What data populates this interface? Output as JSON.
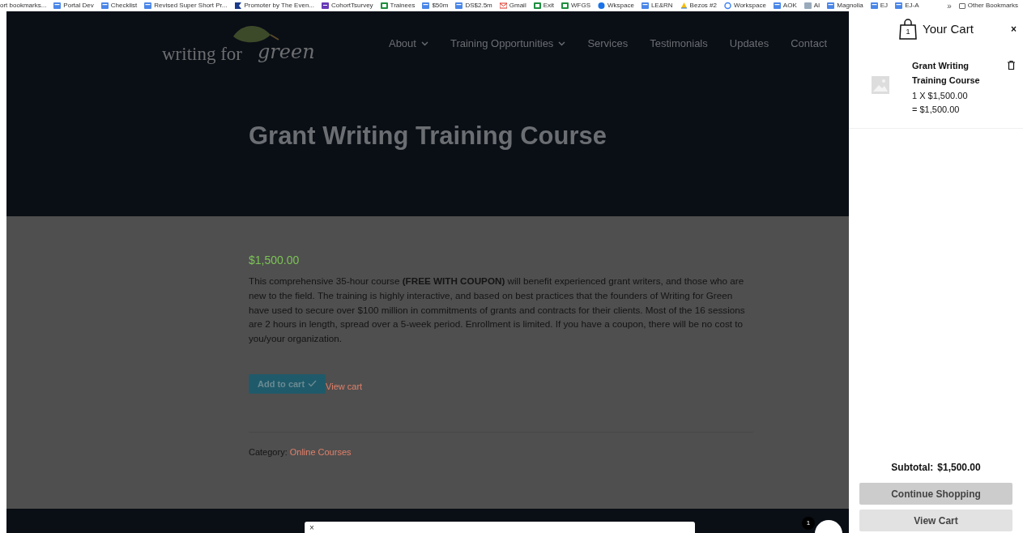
{
  "bookmarks_bar": {
    "items": [
      {
        "label": "ort bookmarks...",
        "kind": "none"
      },
      {
        "label": "Portal Dev",
        "kind": "doc"
      },
      {
        "label": "Checklist",
        "kind": "doc"
      },
      {
        "label": "Revised Super Short Pr...",
        "kind": "doc"
      },
      {
        "label": "Promoter by The Even...",
        "kind": "flag"
      },
      {
        "label": "CohortTsurvey",
        "kind": "form"
      },
      {
        "label": "Trainees",
        "kind": "sheet"
      },
      {
        "label": "$50m",
        "kind": "doc"
      },
      {
        "label": "DS$2.5m",
        "kind": "doc"
      },
      {
        "label": "Gmail",
        "kind": "gmail"
      },
      {
        "label": "Exit",
        "kind": "sheet"
      },
      {
        "label": "WFGS",
        "kind": "sheet"
      },
      {
        "label": "Wkspace",
        "kind": "circle"
      },
      {
        "label": "LE&RN",
        "kind": "doc"
      },
      {
        "label": "Bezos #2",
        "kind": "drive"
      },
      {
        "label": "Workspace",
        "kind": "google"
      },
      {
        "label": "AOK",
        "kind": "doc"
      },
      {
        "label": "AI",
        "kind": "photo"
      },
      {
        "label": "Magnolia",
        "kind": "doc"
      },
      {
        "label": "EJ",
        "kind": "doc"
      },
      {
        "label": "EJ-A",
        "kind": "doc"
      }
    ],
    "more": "»",
    "other": "Other Bookmarks"
  },
  "site": {
    "logo": {
      "text": "writing for",
      "script": "green"
    },
    "nav": [
      {
        "label": "About",
        "dropdown": true
      },
      {
        "label": "Training Opportunities",
        "dropdown": true
      },
      {
        "label": "Services",
        "dropdown": false
      },
      {
        "label": "Testimonials",
        "dropdown": false
      },
      {
        "label": "Updates",
        "dropdown": false
      },
      {
        "label": "Contact",
        "dropdown": false
      }
    ],
    "title": "Grant Writing Training Course"
  },
  "product": {
    "price": "$1,500.00",
    "description": "This comprehensive 35-hour course **(FREE WITH COUPON)** will benefit experienced grant writers, and those who are new to the field. The training is highly interactive, and based on best practices that the founders of Writing for Green have used to secure over $100 million in commitments of grants and contracts for their clients. Most of the 16 sessions are 2 hours in length, spread over a 5-week period. Enrollment is limited. If you have a coupon, there will be no cost to you/your organization.",
    "add_button": "Add to cart",
    "added": true,
    "view_cart": "View cart",
    "category_label": "Category:",
    "category": "Online Courses"
  },
  "popup": {
    "close": "×"
  },
  "scroll_top": {
    "badge": "1"
  },
  "cart": {
    "title": "Your Cart",
    "count": "1",
    "close": "×",
    "items": [
      {
        "name": "Grant Writing Training Course",
        "quantity": "1 X $1,500.00",
        "total": "= $1,500.00"
      }
    ],
    "subtotal_label": "Subtotal:",
    "subtotal": "$1,500.00",
    "buttons": [
      "Continue Shopping",
      "View Cart"
    ]
  }
}
